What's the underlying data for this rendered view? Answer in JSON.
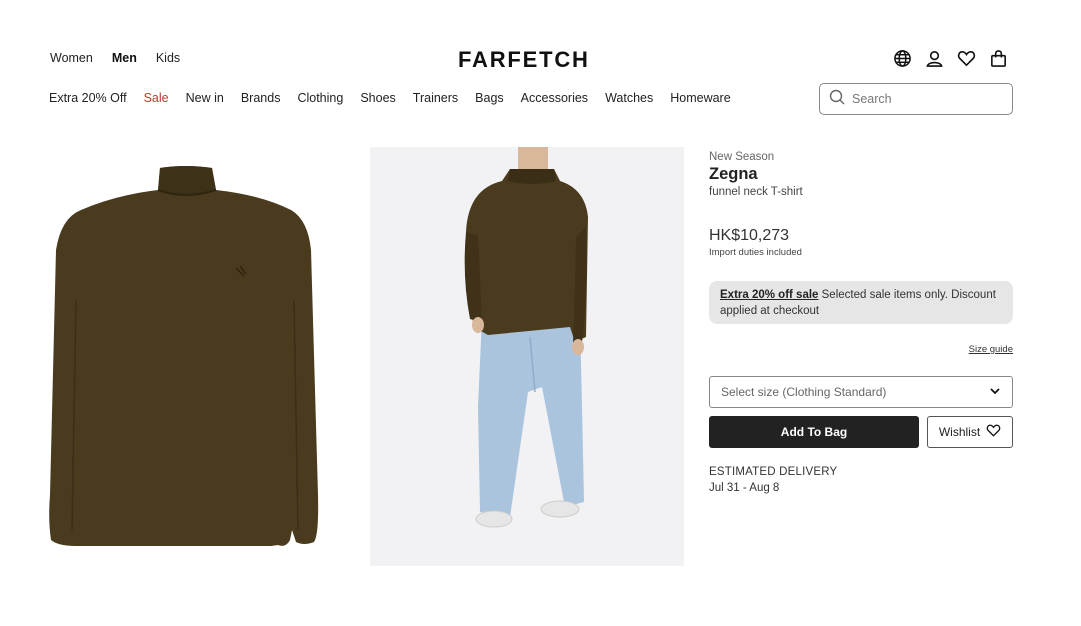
{
  "header": {
    "gender_nav": [
      "Women",
      "Men",
      "Kids"
    ],
    "active_gender": "Men",
    "logo": "FARFETCH",
    "icons": [
      "globe-icon",
      "account-icon",
      "heart-icon",
      "bag-icon"
    ]
  },
  "categories": [
    "Extra 20% Off",
    "Sale",
    "New in",
    "Brands",
    "Clothing",
    "Shoes",
    "Trainers",
    "Bags",
    "Accessories",
    "Watches",
    "Homeware"
  ],
  "search": {
    "placeholder": "Search",
    "value": ""
  },
  "product": {
    "season": "New Season",
    "brand": "Zegna",
    "description": "funnel neck T-shirt",
    "price": "HK$10,273",
    "duties": "Import duties included",
    "promo_link": "Extra 20% off sale",
    "promo_text": " Selected sale items only. Discount applied at checkout",
    "size_guide": "Size guide",
    "size_select": "Select size (Clothing Standard)",
    "add_to_bag": "Add To Bag",
    "wishlist": "Wishlist",
    "delivery_label": "ESTIMATED DELIVERY",
    "delivery_dates": "Jul 31 - Aug 8"
  },
  "colors": {
    "sale": "#c0392b",
    "primary_button": "#222222",
    "promo_bg": "#e6e6e6",
    "shirt": "#4a3b1e",
    "jeans": "#a9c4dc"
  }
}
